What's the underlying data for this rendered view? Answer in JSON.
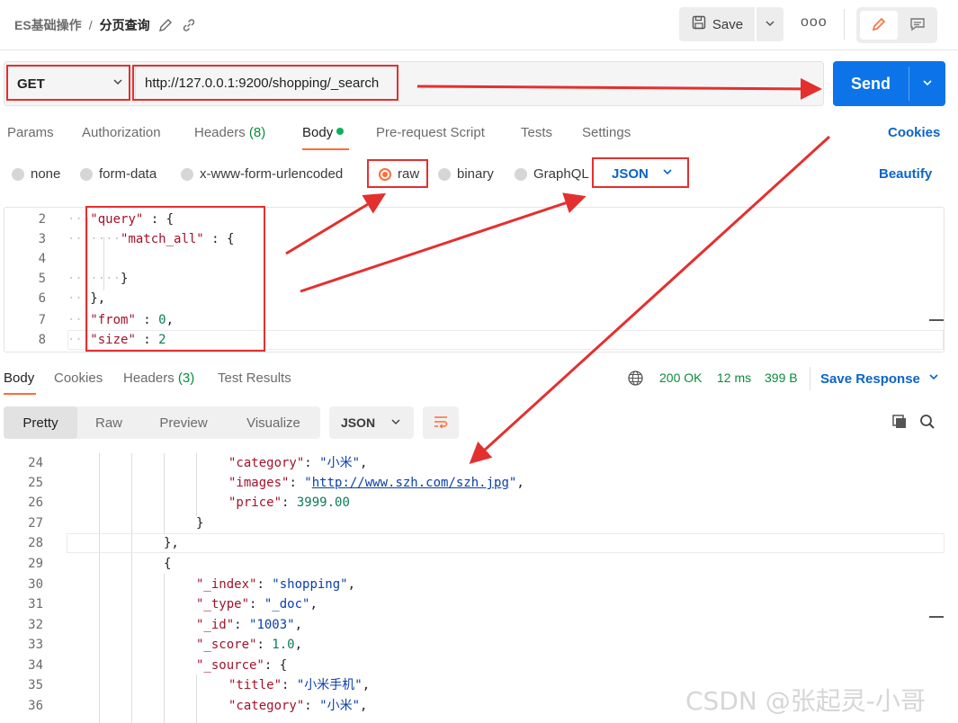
{
  "header": {
    "collection": "ES基础操作",
    "separator": "/",
    "request_name": "分页查询",
    "save_label": "Save",
    "more_label": "ooo"
  },
  "request": {
    "method": "GET",
    "url": "http://127.0.0.1:9200/shopping/_search",
    "send_label": "Send"
  },
  "request_tabs": {
    "params": "Params",
    "authorization": "Authorization",
    "headers": "Headers",
    "headers_count": "(8)",
    "body": "Body",
    "prerequest": "Pre-request Script",
    "tests": "Tests",
    "settings": "Settings",
    "cookies": "Cookies"
  },
  "body_types": {
    "none": "none",
    "form_data": "form-data",
    "urlencoded": "x-www-form-urlencoded",
    "raw": "raw",
    "binary": "binary",
    "graphql": "GraphQL",
    "language": "JSON",
    "beautify": "Beautify"
  },
  "editor_lines": [
    {
      "num": "2",
      "key": "\"query\"",
      "rest": " : {"
    },
    {
      "num": "3",
      "key": "\"match_all\"",
      "rest": " : {"
    },
    {
      "num": "4"
    },
    {
      "num": "5",
      "rest": "}"
    },
    {
      "num": "6",
      "rest": "},"
    },
    {
      "num": "7",
      "key": "\"from\"",
      "sep": " : ",
      "val": "0",
      "tail": ","
    },
    {
      "num": "8",
      "key": "\"size\"",
      "sep": " : ",
      "val": "2"
    }
  ],
  "response_tabs": {
    "body": "Body",
    "cookies": "Cookies",
    "headers": "Headers",
    "headers_count": "(3)",
    "test_results": "Test Results"
  },
  "response_status": {
    "code": "200 OK",
    "time": "12 ms",
    "size": "399 B",
    "save_response": "Save Response"
  },
  "view_tabs": {
    "pretty": "Pretty",
    "raw": "Raw",
    "preview": "Preview",
    "visualize": "Visualize",
    "format": "JSON"
  },
  "response_lines": {
    "l24": {
      "num": "24",
      "key": "\"category\"",
      "val": "\"小米\"",
      "tail": ","
    },
    "l25": {
      "num": "25",
      "key": "\"images\"",
      "q1": "\"",
      "link": "http://www.szh.com/szh.jpg",
      "q2": "\"",
      "tail": ","
    },
    "l26": {
      "num": "26",
      "key": "\"price\"",
      "val": "3999.00"
    },
    "l27": {
      "num": "27",
      "text": "}"
    },
    "l28": {
      "num": "28",
      "text": "},"
    },
    "l29": {
      "num": "29",
      "text": "{"
    },
    "l30": {
      "num": "30",
      "key": "\"_index\"",
      "val": "\"shopping\"",
      "tail": ","
    },
    "l31": {
      "num": "31",
      "key": "\"_type\"",
      "val": "\"_doc\"",
      "tail": ","
    },
    "l32": {
      "num": "32",
      "key": "\"_id\"",
      "val": "\"1003\"",
      "tail": ","
    },
    "l33": {
      "num": "33",
      "key": "\"_score\"",
      "num_val": "1.0",
      "tail": ","
    },
    "l34": {
      "num": "34",
      "key": "\"_source\"",
      "tail": ": {"
    },
    "l35": {
      "num": "35",
      "key": "\"title\"",
      "val": "\"小米手机\"",
      "tail": ","
    },
    "l36": {
      "num": "36",
      "key": "\"category\"",
      "val": "\"小米\"",
      "tail": ","
    }
  },
  "watermark": "CSDN @张起灵-小哥",
  "colors": {
    "accent": "#ff6c37",
    "send_blue": "#0c74e8",
    "link_blue": "#0c64c8",
    "annotation_red": "#e3302f",
    "status_green": "#0a8a3b"
  }
}
